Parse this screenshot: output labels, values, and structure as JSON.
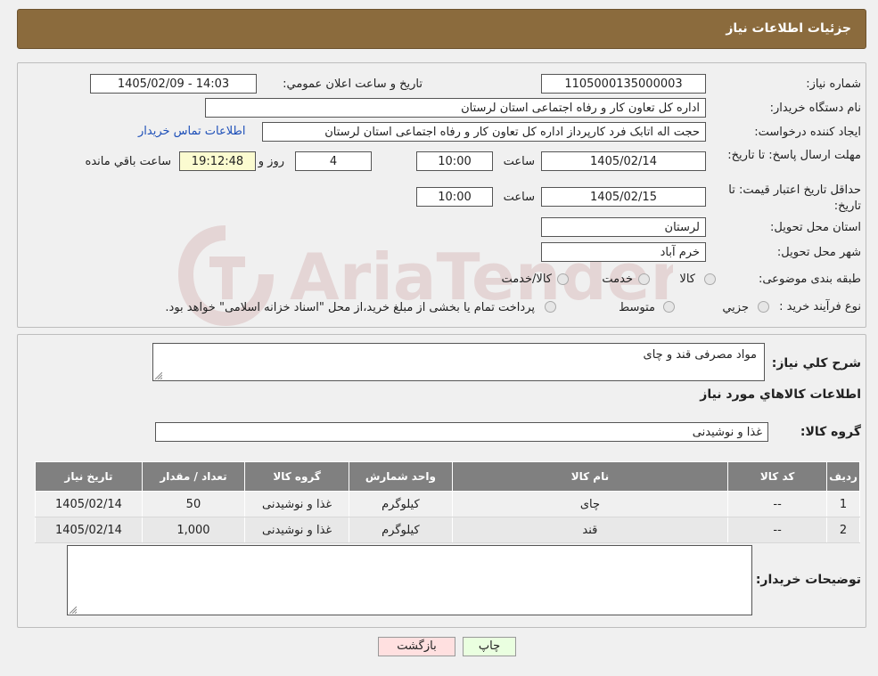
{
  "header": {
    "title": "جزئیات اطلاعات نیاز"
  },
  "fields": {
    "need_number_label": "شماره نیاز:",
    "need_number": "1105000135000003",
    "announce_label": "تاريخ و ساعت اعلان عمومي:",
    "announce_value": "1405/02/09 - 14:03",
    "buyer_org_label": "نام دستگاه خريدار:",
    "buyer_org": "اداره کل تعاون  کار و رفاه اجتماعی استان لرستان",
    "requester_label": "ايجاد کننده درخواست:",
    "requester": "حجت اله اتابک فرد کارپرداز اداره کل تعاون  کار و رفاه اجتماعی استان لرستان",
    "contact_link": "اطلاعات تماس خريدار",
    "deadline_label": "مهلت ارسال پاسخ: تا تاريخ:",
    "deadline_date": "1405/02/14",
    "time_label": "ساعت",
    "deadline_time": "10:00",
    "days_value": "4",
    "days_label": "روز و",
    "remaining_time": "19:12:48",
    "remaining_label": "ساعت باقي مانده",
    "validity_label": "حداقل تاريخ اعتبار قيمت: تا تاريخ:",
    "validity_date": "1405/02/15",
    "validity_time": "10:00",
    "province_label": "استان محل تحويل:",
    "province": "لرستان",
    "city_label": "شهر محل تحويل:",
    "city": "خرم آباد",
    "category_label": "طبقه بندی موضوعی:",
    "category_options": [
      "کالا",
      "خدمت",
      "کالا/خدمت"
    ],
    "process_label": "نوع فرآيند خريد :",
    "process_options": [
      "جزيي",
      "متوسط"
    ],
    "process_note": "پرداخت تمام يا بخشی از مبلغ خريد،از محل \"اسناد خزانه اسلامی\" خواهد بود."
  },
  "description": {
    "label": "شرح کلي نياز:",
    "value": "مواد مصرفی قند و چای",
    "goods_title": "اطلاعات کالاهاي مورد نياز",
    "group_label": "گروه کالا:",
    "group_value": "غذا و نوشیدنی"
  },
  "table": {
    "headers": [
      "رديف",
      "کد کالا",
      "نام کالا",
      "واحد شمارش",
      "گروه کالا",
      "تعداد / مقدار",
      "تاريخ نياز"
    ],
    "rows": [
      [
        "1",
        "--",
        "چای",
        "کیلوگرم",
        "غذا و نوشیدنی",
        "50",
        "1405/02/14"
      ],
      [
        "2",
        "--",
        "قند",
        "کیلوگرم",
        "غذا و نوشیدنی",
        "1,000",
        "1405/02/14"
      ]
    ]
  },
  "buyer_notes": {
    "label": "توضيحات خريدار:",
    "value": ""
  },
  "buttons": {
    "print": "چاپ",
    "back": "بازگشت"
  },
  "colors": {
    "header_bg": "#8b6b3d",
    "table_header_bg": "#808080",
    "link": "#1d4fb8",
    "print_bg": "#eaffe0",
    "back_bg": "#ffe0e0"
  },
  "watermark": {
    "text": "AriaTender.neT"
  }
}
